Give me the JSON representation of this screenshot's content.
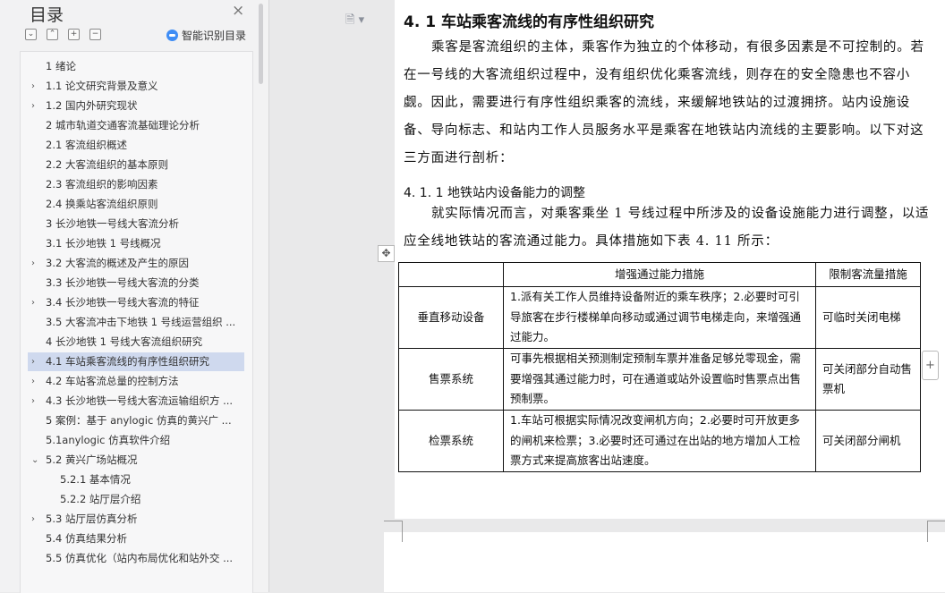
{
  "sidebar": {
    "title": "目录",
    "close_glyph": "×",
    "tools": {
      "collapse": "−",
      "expand": "+",
      "add": "+",
      "remove": "−"
    },
    "smart_toc_label": "智能识别目录",
    "items": [
      {
        "label": "1 绪论",
        "level": 0,
        "expandable": false
      },
      {
        "label": "1.1 论文研究背景及意义",
        "level": 0,
        "expandable": true
      },
      {
        "label": "1.2 国内外研究现状",
        "level": 0,
        "expandable": true
      },
      {
        "label": "2 城市轨道交通客流基础理论分析",
        "level": 0,
        "expandable": false
      },
      {
        "label": "2.1 客流组织概述",
        "level": 0,
        "expandable": false
      },
      {
        "label": "2.2 大客流组织的基本原则",
        "level": 0,
        "expandable": false
      },
      {
        "label": "2.3 客流组织的影响因素",
        "level": 0,
        "expandable": false
      },
      {
        "label": "2.4 换乘站客流组织原则",
        "level": 0,
        "expandable": false
      },
      {
        "label": "3 长沙地铁一号线大客流分析",
        "level": 0,
        "expandable": false
      },
      {
        "label": "3.1 长沙地铁 1 号线概况",
        "level": 0,
        "expandable": false
      },
      {
        "label": "3.2 大客流的概述及产生的原因",
        "level": 0,
        "expandable": true
      },
      {
        "label": "3.3 长沙地铁一号线大客流的分类",
        "level": 0,
        "expandable": false
      },
      {
        "label": "3.4 长沙地铁一号线大客流的特征",
        "level": 0,
        "expandable": true
      },
      {
        "label": "3.5 大客流冲击下地铁 1 号线运营组织 ...",
        "level": 0,
        "expandable": false
      },
      {
        "label": "4 长沙地铁 1 号线大客流组织研究",
        "level": 0,
        "expandable": false
      },
      {
        "label": "4.1 车站乘客流线的有序性组织研究",
        "level": 0,
        "expandable": true,
        "active": true
      },
      {
        "label": "4.2 车站客流总量的控制方法",
        "level": 0,
        "expandable": true
      },
      {
        "label": "4.3 长沙地铁一号线大客流运输组织方 ...",
        "level": 0,
        "expandable": true
      },
      {
        "label": "5 案例：基于 anylogic 仿真的黄兴广 ...",
        "level": 0,
        "expandable": false
      },
      {
        "label": "5.1anylogic 仿真软件介绍",
        "level": 0,
        "expandable": false
      },
      {
        "label": "5.2 黄兴广场站概况",
        "level": 0,
        "expandable": true,
        "expanded": true
      },
      {
        "label": "5.2.1 基本情况",
        "level": 1,
        "expandable": false
      },
      {
        "label": "5.2.2 站厅层介绍",
        "level": 1,
        "expandable": false
      },
      {
        "label": "5.3 站厅层仿真分析",
        "level": 0,
        "expandable": true
      },
      {
        "label": "5.4 仿真结果分析",
        "level": 0,
        "expandable": false
      },
      {
        "label": "5.5 仿真优化（站内布局优化和站外交 ...",
        "level": 0,
        "expandable": false
      }
    ]
  },
  "document": {
    "heading": "4. 1 车站乘客流线的有序性组织研究",
    "para1": "乘客是客流组织的主体，乘客作为独立的个体移动，有很多因素是不可控制的。若在一号线的大客流组织过程中，没有组织优化乘客流线，则存在的安全隐患也不容小觑。因此，需要进行有序性组织乘客的流线，来缓解地铁站的过渡拥挤。站内设施设备、导向标志、和站内工作人员服务水平是乘客在地铁站内流线的主要影响。以下对这三方面进行剖析：",
    "subheading": "4. 1. 1 地铁站内设备能力的调整",
    "para2": "就实际情况而言，对乘客乘坐 1 号线过程中所涉及的设备设施能力进行调整，以适应全线地铁站的客流通过能力。具体措施如下表 4. 11 所示：",
    "table": {
      "headers": [
        "",
        "增强通过能力措施",
        "限制客流量措施"
      ],
      "rows": [
        [
          "垂直移动设备",
          "1.派有关工作人员维持设备附近的乘车秩序；2.必要时可引导旅客在步行楼梯单向移动或通过调节电梯走向，来增强通过能力。",
          "可临时关闭电梯"
        ],
        [
          "售票系统",
          "可事先根据相关预测制定预制车票并准备足够兑零现金，需要增强其通过能力时，可在通道或站外设置临时售票点出售预制票。",
          "可关闭部分自动售票机"
        ],
        [
          "检票系统",
          "1.车站可根据实际情况改变闸机方向；2.必要时可开放更多的闸机来检票；3.必要时还可通过在出站的地方增加人工检票方式来提高旅客出站速度。",
          "可关闭部分闸机"
        ]
      ]
    },
    "move_handle_glyph": "✥",
    "add_col_glyph": "+"
  }
}
